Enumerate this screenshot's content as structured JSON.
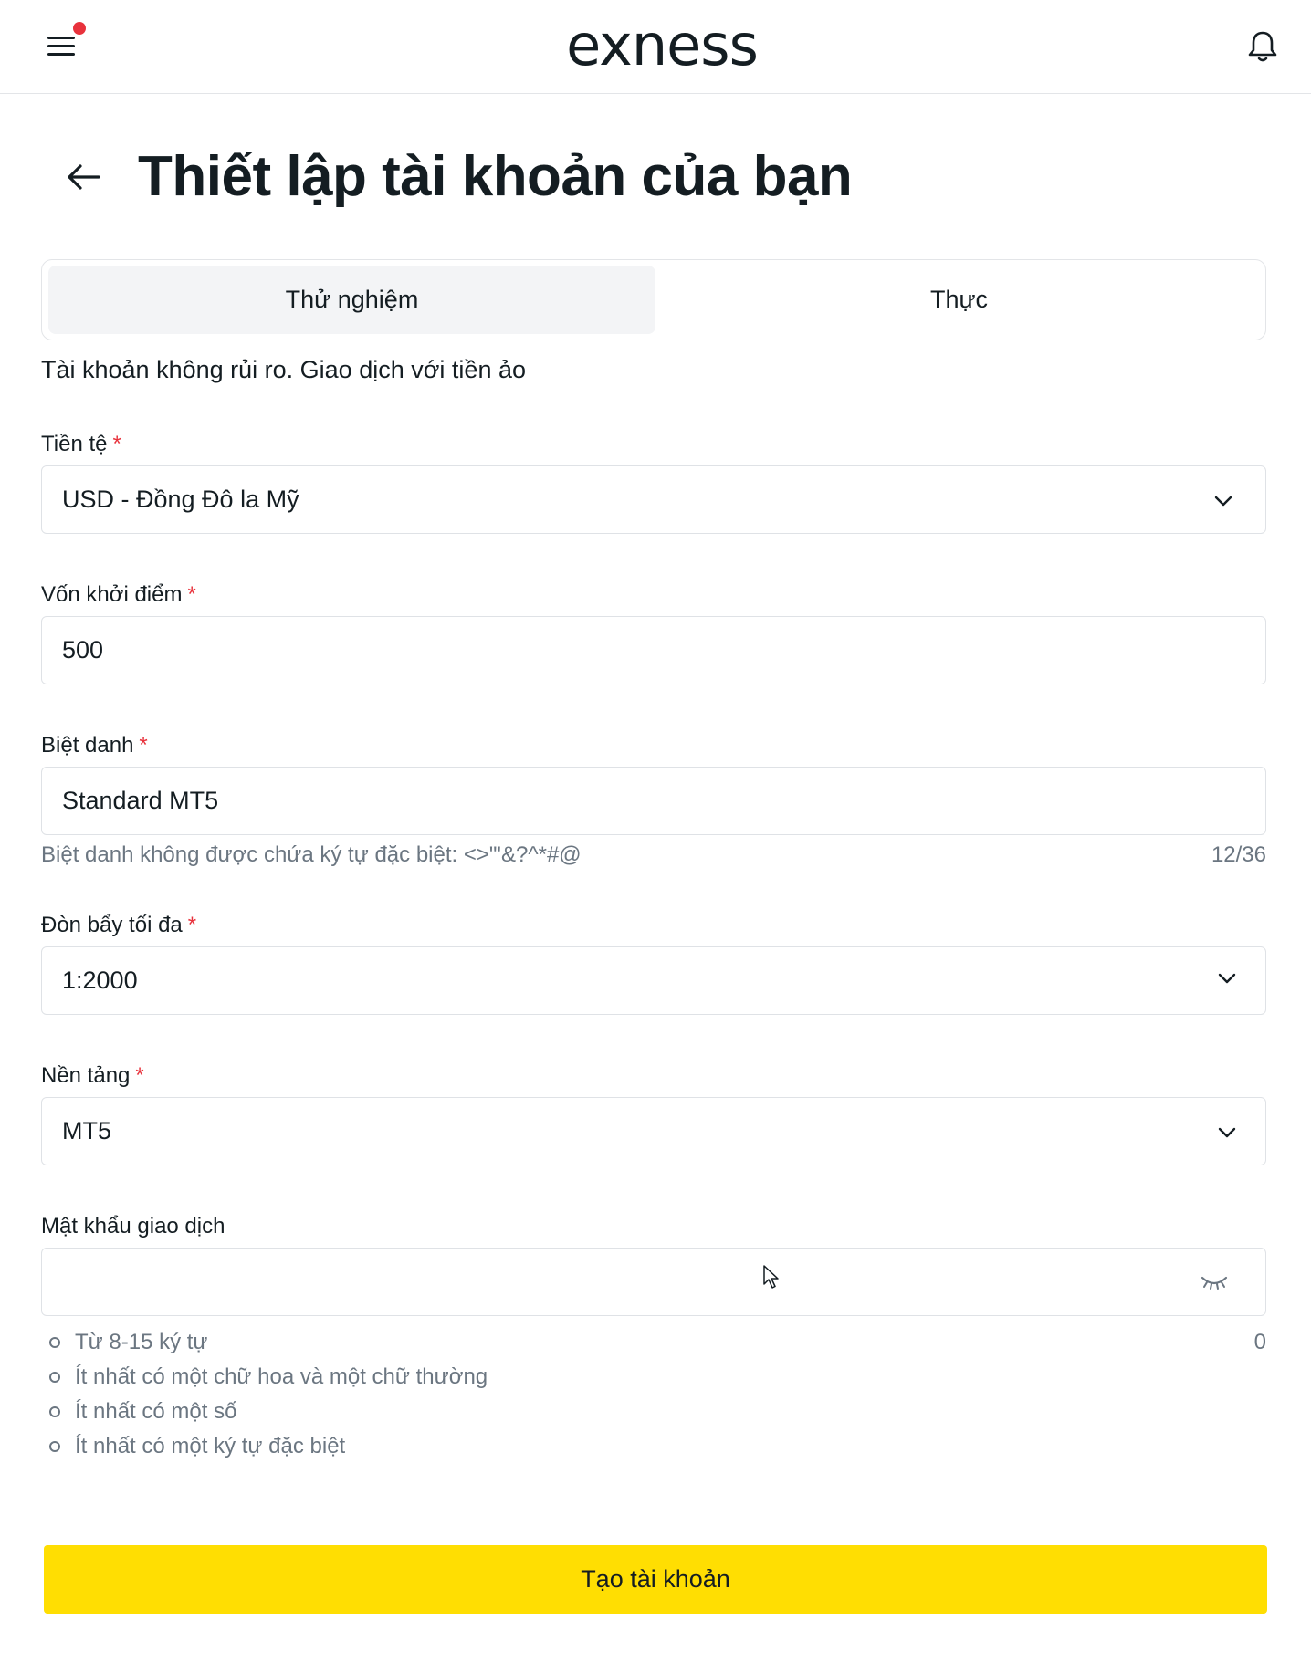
{
  "header": {
    "logo_text": "exness",
    "menu_icon": "hamburger-menu-icon",
    "notification_dot_color": "#e8323c",
    "bell_icon": "bell-icon"
  },
  "page": {
    "title": "Thiết lập tài khoản của bạn",
    "back_icon": "arrow-left-icon"
  },
  "tabs": [
    {
      "label": "Thử nghiệm",
      "active": true
    },
    {
      "label": "Thực",
      "active": false
    }
  ],
  "tab_description": "Tài khoản không rủi ro. Giao dịch với tiền ảo",
  "form": {
    "currency": {
      "label": "Tiền tệ",
      "required": "*",
      "value": "USD - Đồng Đô la Mỹ"
    },
    "initial_balance": {
      "label": "Vốn khởi điểm",
      "required": "*",
      "value": "500"
    },
    "nickname": {
      "label": "Biệt danh",
      "required": "*",
      "value": "Standard MT5",
      "hint": "Biệt danh không được chứa ký tự đặc biệt: <>\"'&?^*#@",
      "counter": "12/36"
    },
    "leverage": {
      "label": "Đòn bẩy tối đa",
      "required": "*",
      "value": "1:2000"
    },
    "platform": {
      "label": "Nền tảng",
      "required": "*",
      "value": "MT5"
    },
    "password": {
      "label": "Mật khẩu giao dịch",
      "value": "",
      "counter": "0",
      "rules": [
        "Từ 8-15 ký tự",
        "Ít nhất có một chữ hoa và một chữ thường",
        "Ít nhất có một số",
        "Ít nhất có một ký tự đặc biệt"
      ]
    }
  },
  "submit_label": "Tạo tài khoản",
  "colors": {
    "accent": "#ffde02",
    "required": "#e8323c",
    "text": "#141d22",
    "muted": "#6b7681",
    "border": "#dfe2e6",
    "active_tab_bg": "#f3f4f6"
  }
}
